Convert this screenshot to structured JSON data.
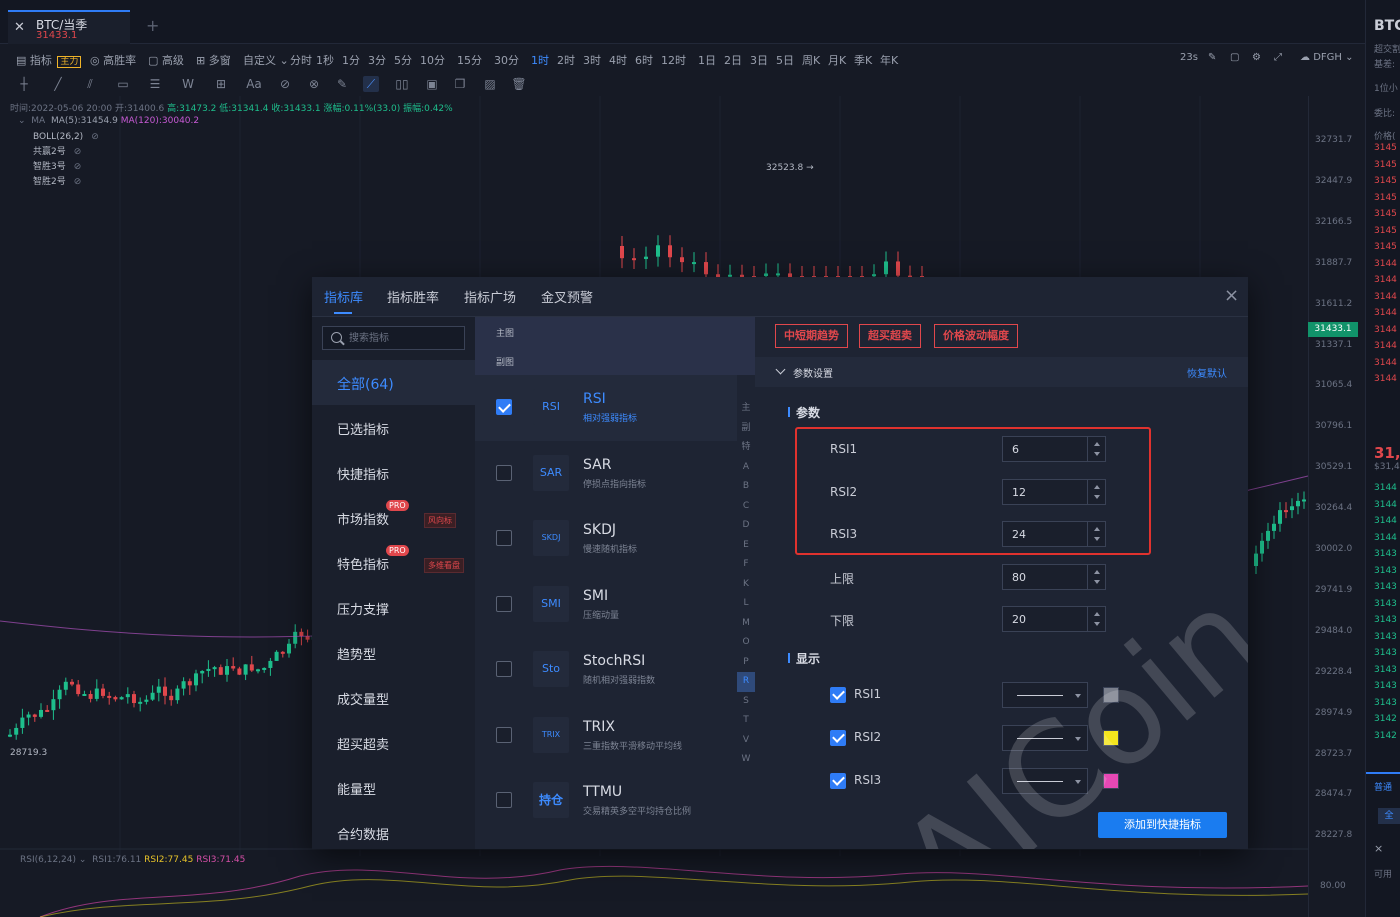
{
  "tab": {
    "icon": "symbol-icon",
    "title": "BTC/当季",
    "price": "31433.1"
  },
  "toolbar": {
    "indicator": "指标",
    "zhuli": "主力",
    "winrate": "高胜率",
    "advanced": "高级",
    "multiwin": "多窗",
    "custom": "自定义",
    "intervals": [
      "分时",
      "1秒",
      "1分",
      "3分",
      "5分",
      "10分",
      "15分",
      "30分",
      "1时",
      "2时",
      "3时",
      "4时",
      "6时",
      "12时",
      "1日",
      "2日",
      "3日",
      "5日",
      "周K",
      "月K",
      "季K",
      "年K"
    ],
    "active_interval": "1时",
    "timer": "23s",
    "user": "DFGH"
  },
  "info": {
    "time": "时间:2022-05-06 20:00",
    "open": "开:31400.6",
    "high": "高:31473.2",
    "low": "低:31341.4",
    "close": "收:31433.1",
    "change": "涨幅:0.11%(33.0)",
    "amplitude": "振幅:0.42%"
  },
  "ma": {
    "name": "MA",
    "ma5": "MA(5):31454.9",
    "ma120": "MA(120):30040.2"
  },
  "overlays": [
    "BOLL(26,2)",
    "共赢2号",
    "智胜3号",
    "智胜2号"
  ],
  "yaxis": [
    "32731.7",
    "32447.9",
    "32166.5",
    "31887.7",
    "31611.2",
    "31337.1",
    "31065.4",
    "30796.1",
    "30529.1",
    "30264.4",
    "30002.0",
    "29741.9",
    "29484.0",
    "29228.4",
    "28974.9",
    "28723.7",
    "28474.7",
    "28227.8"
  ],
  "price_tag": "31433.1",
  "annotations": {
    "high": "32523.8 →",
    "low": "28719.3"
  },
  "rsi": {
    "label": "RSI(6,12,24)",
    "rsi1": "RSI1:76.11",
    "rsi2": "RSI2:77.45",
    "rsi3": "RSI3:71.45",
    "axis": "80.00"
  },
  "side": {
    "title": "BTC",
    "sub1": "超交割",
    "sub2": "基差:",
    "sub3": "1位小",
    "sub4": "委比:",
    "sub5": "价格(",
    "big_price": "31,4",
    "big_sub": "$31,4",
    "asks": [
      "3145",
      "3145",
      "3145",
      "3145",
      "3145",
      "3145",
      "3145",
      "3144",
      "3144",
      "3144",
      "3144",
      "3144",
      "3144",
      "3144",
      "3144"
    ],
    "bids": [
      "3144",
      "3144",
      "3144",
      "3144",
      "3143",
      "3143",
      "3143",
      "3143",
      "3143",
      "3143",
      "3143",
      "3143",
      "3143",
      "3143",
      "3142",
      "3142"
    ],
    "tab": "普通",
    "btn": "全",
    "close": "×",
    "avail": "可用"
  },
  "modal": {
    "tabs": [
      "指标库",
      "指标胜率",
      "指标广场",
      "金叉预警"
    ],
    "close_icon": "×",
    "search_placeholder": "搜索指标",
    "categories": [
      {
        "label": "全部(64)"
      },
      {
        "label": "已选指标"
      },
      {
        "label": "快捷指标"
      },
      {
        "label": "市场指数",
        "pro": "PRO",
        "tag": "风向标"
      },
      {
        "label": "特色指标",
        "pro": "PRO",
        "tag": "多维看盘"
      },
      {
        "label": "压力支撑"
      },
      {
        "label": "趋势型"
      },
      {
        "label": "成交量型"
      },
      {
        "label": "超买超卖"
      },
      {
        "label": "能量型"
      },
      {
        "label": "合约数据"
      }
    ],
    "mid_header": {
      "main": "主图",
      "sub": "副图"
    },
    "indicators": [
      {
        "icon": "RSI",
        "name": "RSI",
        "desc": "相对强弱指标",
        "checked": true
      },
      {
        "icon": "SAR",
        "name": "SAR",
        "desc": "停损点指向指标",
        "checked": false
      },
      {
        "icon": "SKDJ",
        "name": "SKDJ",
        "desc": "慢速随机指标",
        "checked": false
      },
      {
        "icon": "SMI",
        "name": "SMI",
        "desc": "压缩动量",
        "checked": false
      },
      {
        "icon": "Sto",
        "name": "StochRSI",
        "desc": "随机相对强弱指数",
        "checked": false
      },
      {
        "icon": "TRIX",
        "name": "TRIX",
        "desc": "三重指数平滑移动平均线",
        "checked": false
      },
      {
        "icon": "持仓",
        "name": "TTMU",
        "desc": "交易精英多空平均持仓比例",
        "checked": false
      }
    ],
    "alpha": [
      "主",
      "副",
      "特",
      "A",
      "B",
      "C",
      "D",
      "E",
      "F",
      "K",
      "L",
      "M",
      "O",
      "P",
      "R",
      "S",
      "T",
      "V",
      "W"
    ],
    "alpha_active": "R",
    "red_tags": [
      "中短期趋势",
      "超买超卖",
      "价格波动幅度"
    ],
    "param_section": "参数设置",
    "reset": "恢复默认",
    "params_title": "参数",
    "params": [
      {
        "label": "RSI1",
        "value": "6"
      },
      {
        "label": "RSI2",
        "value": "12"
      },
      {
        "label": "RSI3",
        "value": "24"
      },
      {
        "label": "上限",
        "value": "80"
      },
      {
        "label": "下限",
        "value": "20"
      }
    ],
    "display_title": "显示",
    "display": [
      {
        "label": "RSI1",
        "color": "#7a7f8c"
      },
      {
        "label": "RSI2",
        "color": "#f5e61e"
      },
      {
        "label": "RSI3",
        "color": "#e648b4"
      }
    ],
    "add_button": "添加到快捷指标"
  },
  "watermark": "AICoin"
}
